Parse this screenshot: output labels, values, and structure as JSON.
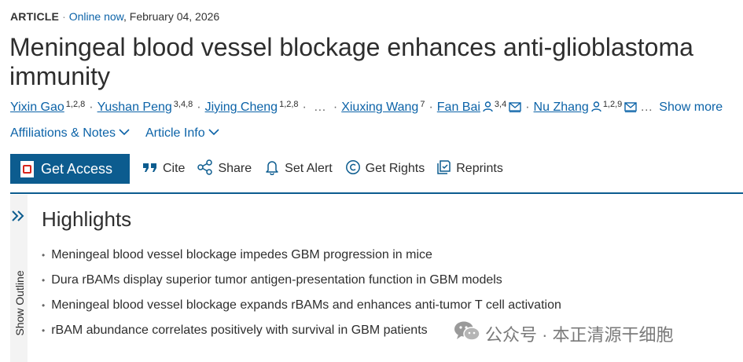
{
  "meta": {
    "type": "ARTICLE",
    "separator": "·",
    "status": "Online now",
    "date": ", February 04, 2026"
  },
  "title": "Meningeal blood vessel blockage enhances anti-glioblastoma immunity",
  "authors": [
    {
      "name": "Yixin Gao",
      "sup": "1,2,8"
    },
    {
      "name": "Yushan Peng",
      "sup": "3,4,8"
    },
    {
      "name": "Jiying Cheng",
      "sup": "1,2,8"
    },
    {
      "name": "Xiuxing Wang",
      "sup": "7"
    },
    {
      "name": "Fan Bai",
      "sup": "3,4"
    },
    {
      "name": "Nu Zhang",
      "sup": "1,2,9"
    }
  ],
  "author_separator": "·",
  "ellipsis": "…",
  "show_more": "Show more",
  "links": {
    "affiliations": "Affiliations & Notes",
    "article_info": "Article Info"
  },
  "toolbar": {
    "get_access": "Get Access",
    "cite": "Cite",
    "share": "Share",
    "set_alert": "Set Alert",
    "get_rights": "Get Rights",
    "reprints": "Reprints"
  },
  "sidebar": {
    "label": "Show Outline"
  },
  "highlights": {
    "title": "Highlights",
    "bullet": "•",
    "items": [
      "Meningeal blood vessel blockage impedes GBM progression in mice",
      "Dura rBAMs display superior tumor antigen-presentation function in GBM models",
      "Meningeal blood vessel blockage expands rBAMs and enhances anti-tumor T cell activation",
      "rBAM abundance correlates positively with survival in GBM patients"
    ]
  },
  "watermark": "公众号 · 本正清源干细胞",
  "colors": {
    "link": "#0c63a8",
    "accent": "#0c5c8f",
    "text": "#2e2e2e"
  },
  "icons": [
    "pdf-icon",
    "quote-icon",
    "share-icon",
    "bell-icon",
    "copyright-icon",
    "reprint-icon",
    "person-icon",
    "envelope-icon",
    "chevron-down-icon",
    "double-chevron-right-icon",
    "wechat-icon"
  ]
}
